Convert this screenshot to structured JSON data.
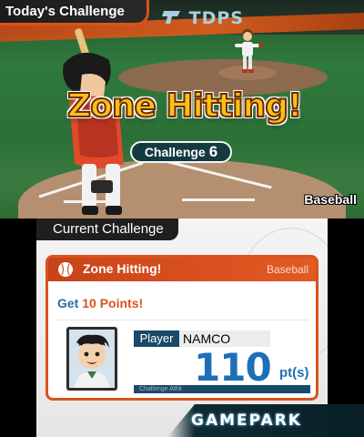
{
  "top_screen": {
    "tab_label": "Today's Challenge",
    "stadium_sign": "TDPS",
    "event_title": "Zone Hitting!",
    "challenge_word": "Challenge",
    "challenge_number": "6",
    "sport_label": "Baseball"
  },
  "bottom_screen": {
    "tab_label": "Current Challenge",
    "card": {
      "title": "Zone Hitting!",
      "sport": "Baseball",
      "goal_prefix": "Get",
      "goal_points": "10 Points!",
      "player_label": "Player",
      "player_name": "NAMCO",
      "score": "110",
      "score_unit": "pt(s)",
      "bar_text": "Challenge Athli"
    }
  },
  "watermark": "GAMEPARK",
  "colors": {
    "accent_orange": "#d9531b",
    "title_yellow": "#f8c11a",
    "score_blue": "#1e6fb6",
    "label_navy": "#1a4a6a"
  }
}
